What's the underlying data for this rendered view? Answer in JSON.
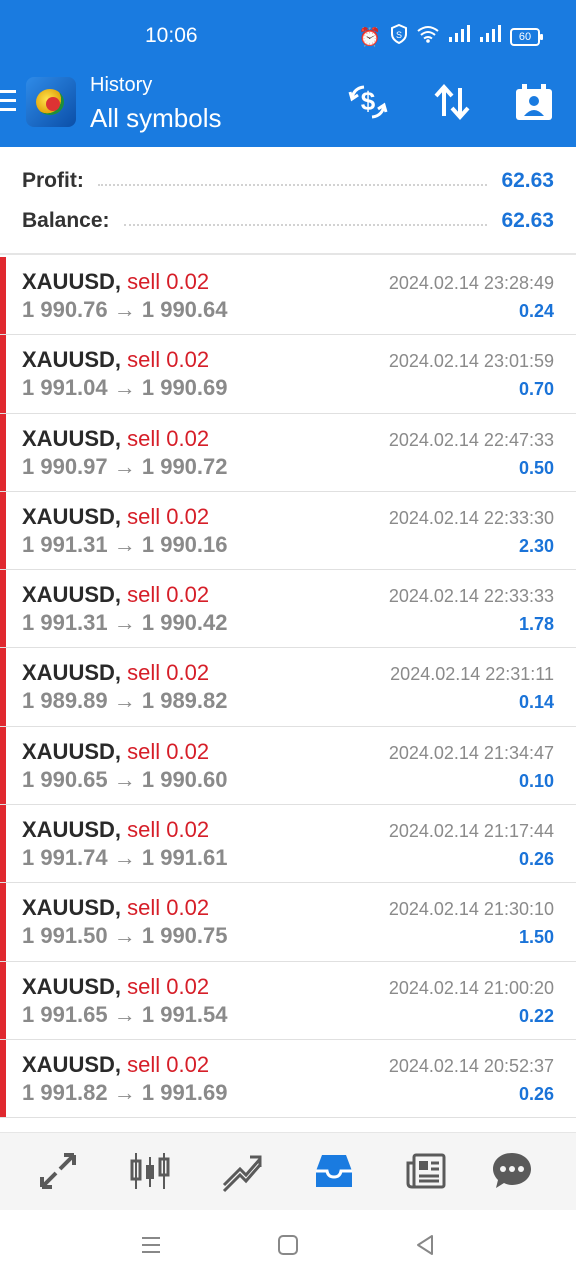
{
  "status_bar": {
    "time": "10:06",
    "battery": "60",
    "icons": [
      "alarm-icon",
      "shield-icon",
      "wifi-icon",
      "signal-icon",
      "signal-icon",
      "battery-icon"
    ]
  },
  "app_bar": {
    "subtitle": "History",
    "title": "All symbols",
    "actions": [
      "currency-exchange-icon",
      "sort-icon",
      "calendar-icon"
    ]
  },
  "summary": {
    "profit_label": "Profit:",
    "profit_value": "62.63",
    "balance_label": "Balance:",
    "balance_value": "62.63"
  },
  "deals": [
    {
      "symbol": "XAUUSD,",
      "side": "sell 0.02",
      "time": "2024.02.14 23:28:49",
      "prices": "1 990.76 → 1 990.64",
      "profit": "0.24"
    },
    {
      "symbol": "XAUUSD,",
      "side": "sell 0.02",
      "time": "2024.02.14 23:01:59",
      "prices": "1 991.04 → 1 990.69",
      "profit": "0.70"
    },
    {
      "symbol": "XAUUSD,",
      "side": "sell 0.02",
      "time": "2024.02.14 22:47:33",
      "prices": "1 990.97 → 1 990.72",
      "profit": "0.50"
    },
    {
      "symbol": "XAUUSD,",
      "side": "sell 0.02",
      "time": "2024.02.14 22:33:30",
      "prices": "1 991.31 → 1 990.16",
      "profit": "2.30"
    },
    {
      "symbol": "XAUUSD,",
      "side": "sell 0.02",
      "time": "2024.02.14 22:33:33",
      "prices": "1 991.31 → 1 990.42",
      "profit": "1.78"
    },
    {
      "symbol": "XAUUSD,",
      "side": "sell 0.02",
      "time": "2024.02.14 22:31:11",
      "prices": "1 989.89 → 1 989.82",
      "profit": "0.14"
    },
    {
      "symbol": "XAUUSD,",
      "side": "sell 0.02",
      "time": "2024.02.14 21:34:47",
      "prices": "1 990.65 → 1 990.60",
      "profit": "0.10"
    },
    {
      "symbol": "XAUUSD,",
      "side": "sell 0.02",
      "time": "2024.02.14 21:17:44",
      "prices": "1 991.74 → 1 991.61",
      "profit": "0.26"
    },
    {
      "symbol": "XAUUSD,",
      "side": "sell 0.02",
      "time": "2024.02.14 21:30:10",
      "prices": "1 991.50 → 1 990.75",
      "profit": "1.50"
    },
    {
      "symbol": "XAUUSD,",
      "side": "sell 0.02",
      "time": "2024.02.14 21:00:20",
      "prices": "1 991.65 → 1 991.54",
      "profit": "0.22"
    },
    {
      "symbol": "XAUUSD,",
      "side": "sell 0.02",
      "time": "2024.02.14 20:52:37",
      "prices": "1 991.82 → 1 991.69",
      "profit": "0.26"
    }
  ],
  "bottom_nav": [
    "quotes-icon",
    "chart-icon",
    "trade-icon",
    "history-icon",
    "news-icon",
    "chat-icon"
  ],
  "colors": {
    "header": "#1a7be0",
    "sell": "#d61e28",
    "profit": "#1a73d8",
    "active_nav": "#1a7be0",
    "inactive_nav": "#5a5a5a"
  }
}
